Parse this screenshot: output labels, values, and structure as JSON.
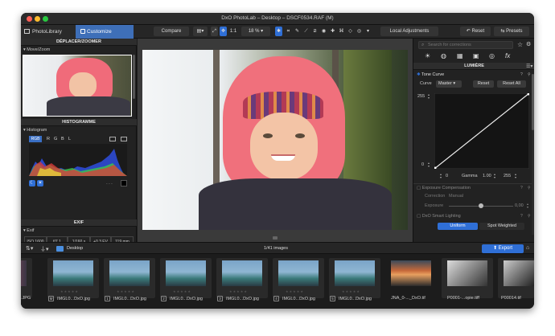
{
  "window": {
    "title": "DxO PhotoLab – Desktop – DSCF0534.RAF (M)"
  },
  "toolbar": {
    "tab_photolibrary": "PhotoLibrary",
    "tab_customize": "Customize",
    "compare": "Compare",
    "zoom_1to1": "1:1",
    "zoom_level": "18 %",
    "local_adjustments": "Local Adjustments",
    "reset": "Reset",
    "presets": "Presets"
  },
  "left_panel": {
    "move_zoom_header": "DÉPLACER/ZOOMER",
    "move_zoom_sub": "Move/Zoom",
    "histogram_header": "HISTOGRAMME",
    "histogram_sub": "Histogram",
    "channels": [
      "RGB",
      "R",
      "G",
      "B",
      "L"
    ],
    "exif_header": "EXIF",
    "exif_sub": "Exif",
    "exif_values": [
      "ISO 1600",
      "f/7.1",
      "1/160 s",
      "+0.3 EV",
      "119 mm"
    ]
  },
  "right_panel": {
    "search_placeholder": "Search for corrections",
    "section_title": "LUMIÈRE",
    "tone_curve_title": "Tone Curve",
    "curve_label": "Curve",
    "curve_channel": "Master",
    "reset_button": "Reset",
    "reset_all_button": "Reset All",
    "y_max": "255",
    "y_min": "0",
    "x_min": "0",
    "gamma_label": "Gamma",
    "gamma_value": "1.00",
    "x_max": "255",
    "exposure_comp_title": "Exposure Compensation",
    "correction_label": "Correction",
    "correction_value": "Manual",
    "exposure_label": "Exposure",
    "exposure_value": "0,00",
    "smart_lighting_title": "DxO Smart Lighting",
    "uniform_button": "Uniform",
    "spot_weighted_button": "Spot Weighted"
  },
  "filmstrip_bar": {
    "folder_name": "Desktop",
    "image_count": "1/41 images",
    "export_button": "Export"
  },
  "filmstrip": [
    {
      "name": ".JPG",
      "num": ""
    },
    {
      "name": "IMGL0...DxO.jpg",
      "num": "M"
    },
    {
      "name": "IMGL0...DxO.jpg",
      "num": "1"
    },
    {
      "name": "IMGL0...DxO.jpg",
      "num": "2"
    },
    {
      "name": "IMGL0...DxO.jpg",
      "num": "3"
    },
    {
      "name": "IMGL0...DxO.jpg",
      "num": "4"
    },
    {
      "name": "IMGL0...DxO.jpg",
      "num": "5"
    },
    {
      "name": "JNA_0-..._DxO.tif",
      "num": ""
    },
    {
      "name": "P0001-...opie.tiff",
      "num": ""
    },
    {
      "name": "P00014.tif",
      "num": ""
    }
  ],
  "colors": {
    "accent_blue": "#2f6fd6",
    "active_tab": "#3e6fb8",
    "chrome_dark": "#1e1e1e"
  }
}
